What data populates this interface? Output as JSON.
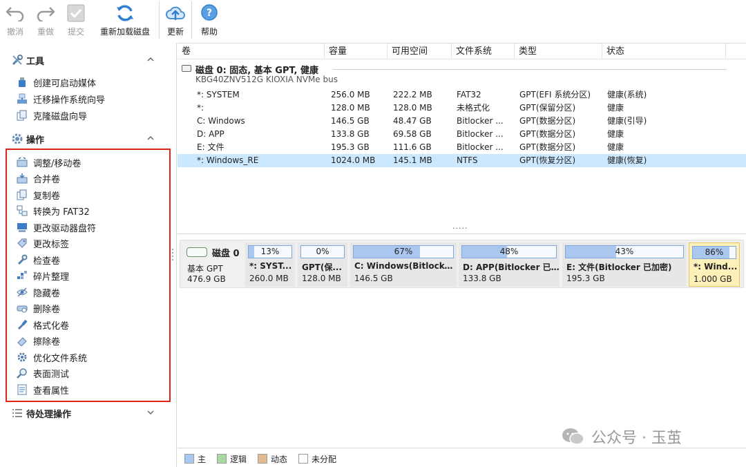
{
  "toolbar": {
    "undo": "撤消",
    "redo": "重做",
    "commit": "提交",
    "reload_disk": "重新加载磁盘",
    "update": "更新",
    "help": "帮助"
  },
  "sidebar": {
    "tools": {
      "title": "工具",
      "items": [
        "创建可启动媒体",
        "迁移操作系统向导",
        "克隆磁盘向导"
      ]
    },
    "operations": {
      "title": "操作",
      "items": [
        "调整/移动卷",
        "合并卷",
        "复制卷",
        "转换为 FAT32",
        "更改驱动器盘符",
        "更改标签",
        "检查卷",
        "碎片整理",
        "隐藏卷",
        "删除卷",
        "格式化卷",
        "擦除卷",
        "优化文件系统",
        "表面测试",
        "查看属性"
      ]
    },
    "pending": {
      "title": "待处理操作"
    }
  },
  "volume_table": {
    "columns": [
      "卷",
      "容量",
      "可用空间",
      "文件系统",
      "类型",
      "状态"
    ],
    "disk": {
      "title": "磁盘  0: 固态, 基本 GPT, 健康",
      "subtitle": "KBG40ZNV512G KIOXIA NVMe bus"
    },
    "rows": [
      {
        "vol": "*: SYSTEM",
        "cap": "256.0 MB",
        "free": "222.2 MB",
        "fs": "FAT32",
        "type": "GPT(EFI 系统分区)",
        "status": "健康(系统)"
      },
      {
        "vol": "*:",
        "cap": "128.0 MB",
        "free": "128.0 MB",
        "fs": "未格式化",
        "type": "GPT(保留分区)",
        "status": "健康"
      },
      {
        "vol": "C: Windows",
        "cap": "146.5 GB",
        "free": "48.47 GB",
        "fs": "Bitlocker ...",
        "type": "GPT(数据分区)",
        "status": "健康(引导)"
      },
      {
        "vol": "D: APP",
        "cap": "133.8 GB",
        "free": "69.58 GB",
        "fs": "Bitlocker ...",
        "type": "GPT(数据分区)",
        "status": "健康"
      },
      {
        "vol": "E: 文件",
        "cap": "195.3 GB",
        "free": "111.6 GB",
        "fs": "Bitlocker ...",
        "type": "GPT(数据分区)",
        "status": "健康"
      },
      {
        "vol": "*: Windows_RE",
        "cap": "1024.0 MB",
        "free": "145.1 MB",
        "fs": "NTFS",
        "type": "GPT(恢复分区)",
        "status": "健康(恢复)"
      }
    ],
    "selected_row": 5,
    "more_dots": "....."
  },
  "disk_map": {
    "disk": {
      "title": "磁盘  0",
      "type": "基本 GPT",
      "size": "476.9 GB"
    },
    "partitions": [
      {
        "pct": "13%",
        "used": 0.13,
        "name": "*: SYST...",
        "size": "260.0 MB"
      },
      {
        "pct": "0%",
        "used": 0.0,
        "name": "GPT(保...",
        "size": "128.0 MB"
      },
      {
        "pct": "67%",
        "used": 0.67,
        "name": "C: Windows(Bitlocker...",
        "size": "146.5 GB"
      },
      {
        "pct": "48%",
        "used": 0.48,
        "name": "D: APP(Bitlocker 已...",
        "size": "133.8 GB"
      },
      {
        "pct": "43%",
        "used": 0.43,
        "name": "E: 文件(Bitlocker 已加密)",
        "size": "195.3 GB"
      },
      {
        "pct": "86%",
        "used": 0.86,
        "name": "*: Wind...",
        "size": "1.000 GB"
      }
    ]
  },
  "legend": {
    "primary": {
      "label": "主",
      "color": "#a9c7ef"
    },
    "logical": {
      "label": "逻辑",
      "color": "#a8d8a0"
    },
    "dynamic": {
      "label": "动态",
      "color": "#e4b990"
    },
    "unallocated": {
      "label": "未分配",
      "color": "#ffffff"
    }
  },
  "watermark": "公众号 · 玉茧",
  "colors": {
    "selection": "#cce8ff",
    "highlight_box": "#e2231a",
    "bar_fill": "#a9c7ef",
    "selected_partition": "#fdf0b8"
  }
}
